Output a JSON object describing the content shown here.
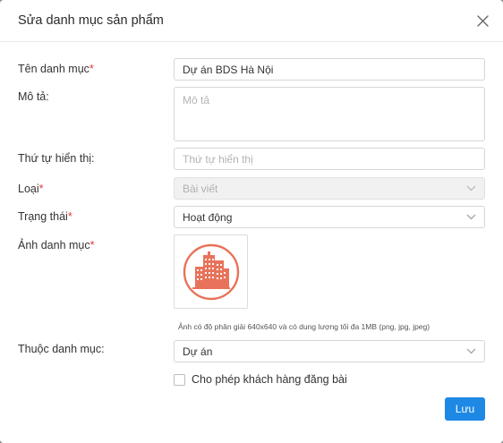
{
  "dialog": {
    "title": "Sửa danh mục sản phẩm",
    "close_icon": "close-icon"
  },
  "form": {
    "name": {
      "label": "Tên danh mục",
      "required": true,
      "value": "Dự án BDS Hà Nội"
    },
    "description": {
      "label": "Mô tả:",
      "placeholder": "Mô tả",
      "value": ""
    },
    "order": {
      "label": "Thứ tự hiển thị:",
      "placeholder": "Thứ tự hiển thị",
      "value": ""
    },
    "type": {
      "label": "Loại",
      "required": true,
      "value": "Bài viết",
      "disabled": true
    },
    "status": {
      "label": "Trạng thái",
      "required": true,
      "value": "Hoạt động"
    },
    "image": {
      "label": "Ảnh danh mục",
      "required": true,
      "icon": "buildings-icon",
      "hint": "Ảnh có độ phân giải 640x640 và có dung lượng tối đa 1MB (png, jpg, jpeg)"
    },
    "parent": {
      "label": "Thuộc danh mục:",
      "value": "Dự án"
    },
    "allow_posting": {
      "label": "Cho phép khách hàng đăng bài",
      "checked": false
    }
  },
  "actions": {
    "save_label": "Lưu"
  },
  "colors": {
    "primary": "#1e88e5",
    "required": "#e53935",
    "icon_accent": "#e8735a"
  }
}
